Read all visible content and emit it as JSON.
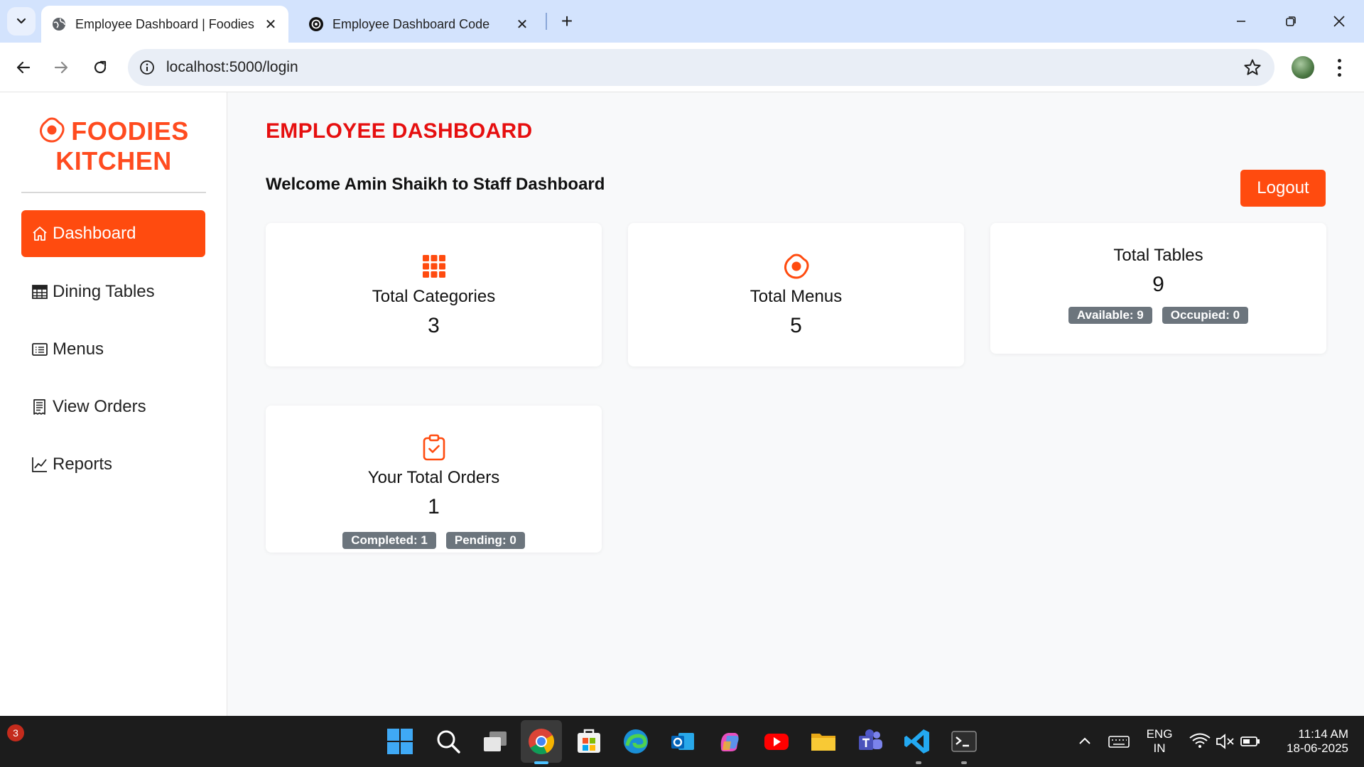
{
  "browser": {
    "tabs": [
      {
        "title": "Employee Dashboard | Foodies",
        "active": true
      },
      {
        "title": "Employee Dashboard Code",
        "active": false
      }
    ],
    "url": "localhost:5000/login"
  },
  "sidebar": {
    "brand_line1": "FOODIES",
    "brand_line2": "KITCHEN",
    "items": [
      {
        "label": "Dashboard",
        "icon": "home-icon",
        "active": true
      },
      {
        "label": "Dining Tables",
        "icon": "table-icon",
        "active": false
      },
      {
        "label": "Menus",
        "icon": "list-icon",
        "active": false
      },
      {
        "label": "View Orders",
        "icon": "receipt-icon",
        "active": false
      },
      {
        "label": "Reports",
        "icon": "chart-line-icon",
        "active": false
      }
    ]
  },
  "main": {
    "title": "EMPLOYEE DASHBOARD",
    "welcome": "Welcome Amin Shaikh to Staff Dashboard",
    "logout_label": "Logout",
    "cards": {
      "categories": {
        "label": "Total Categories",
        "value": "3",
        "icon": "grid-icon"
      },
      "menus": {
        "label": "Total Menus",
        "value": "5",
        "icon": "egg-icon"
      },
      "tables": {
        "label": "Total Tables",
        "value": "9",
        "badges": [
          "Available: 9",
          "Occupied: 0"
        ]
      },
      "orders": {
        "label": "Your Total Orders",
        "value": "1",
        "icon": "clipboard-check-icon",
        "badges": [
          "Completed: 1",
          "Pending: 0"
        ]
      }
    }
  },
  "colors": {
    "accent": "#ff4b0f",
    "title_red": "#e60f0f",
    "badge_gray": "#6c757d"
  },
  "taskbar": {
    "notification_count": "3",
    "language_line1": "ENG",
    "language_line2": "IN",
    "time": "11:14 AM",
    "date": "18-06-2025"
  }
}
